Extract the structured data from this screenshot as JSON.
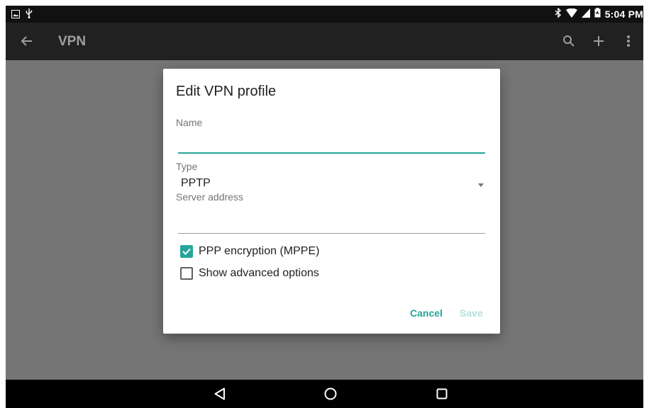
{
  "status_bar": {
    "time": "5:04 PM",
    "left_icons": [
      "gallery-icon",
      "usb-icon"
    ],
    "right_icons": [
      "bluetooth-icon",
      "wifi-icon",
      "signal-icon",
      "battery-icon"
    ]
  },
  "toolbar": {
    "title": "VPN",
    "back_icon": "back-arrow-icon",
    "actions": [
      "search-icon",
      "add-icon",
      "more-vert-icon"
    ]
  },
  "dialog": {
    "title": "Edit VPN profile",
    "name": {
      "label": "Name",
      "value": ""
    },
    "type": {
      "label": "Type",
      "value": "PPTP"
    },
    "server": {
      "label": "Server address",
      "value": ""
    },
    "ppp_encryption": {
      "label": "PPP encryption (MPPE)",
      "checked": true
    },
    "advanced": {
      "label": "Show advanced options",
      "checked": false
    },
    "cancel_label": "Cancel",
    "save_label": "Save"
  },
  "colors": {
    "accent": "#26a69a",
    "accent_disabled": "#b2dfdb",
    "toolbar": "#212121",
    "scrim": "#757575"
  },
  "nav_bar": [
    "back-nav-icon",
    "home-nav-icon",
    "recents-nav-icon"
  ]
}
